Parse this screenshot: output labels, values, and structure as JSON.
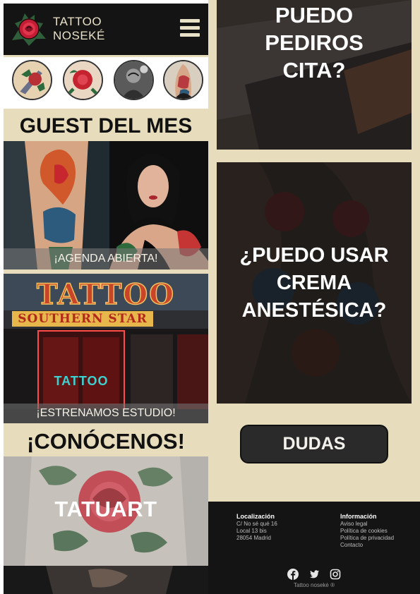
{
  "header": {
    "brand_line1": "TATTOO",
    "brand_line2": "NOSEKÉ",
    "menu_icon": "hamburger-menu-icon"
  },
  "thumbnails": [
    {
      "name": "thumb-dagger-tattoo"
    },
    {
      "name": "thumb-rose-tattoo"
    },
    {
      "name": "thumb-bw-portrait-tattoo"
    },
    {
      "name": "thumb-arm-sleeve-tattoo"
    }
  ],
  "guest": {
    "title": "GUEST DEL MES",
    "caption": "¡AGENDA ABIERTA!"
  },
  "studio": {
    "sign_top": "TATTOO",
    "sign_bottom": "SOUTHERN STAR",
    "window_text": "TATTOO",
    "caption": "¡ESTRENAMOS ESTUDIO!"
  },
  "about": {
    "title": "¡CONÓCENOS!",
    "tatuart_label": "TATUART"
  },
  "faq": {
    "card1": [
      "PUEDO",
      "PEDIROS",
      "CITA?"
    ],
    "card2": [
      "¿PUEDO USAR",
      "CREMA",
      "ANESTÉSICA?"
    ],
    "dudas_button": "DUDAS"
  },
  "footer": {
    "location_heading": "Localización",
    "location_lines": [
      "C/ No sé qué 16",
      "Local 13 bis",
      "28054 Madrid"
    ],
    "info_heading": "Información",
    "info_links": [
      "Aviso legal",
      "Política de cookies",
      "Política de privacidad",
      "Contacto"
    ],
    "social_icons": [
      "facebook-icon",
      "twitter-icon",
      "instagram-icon"
    ],
    "copyright": "Tattoo nosekė ®"
  },
  "colors": {
    "cream": "#e7dcbc",
    "dark": "#141414",
    "button": "#2a2a2a"
  }
}
